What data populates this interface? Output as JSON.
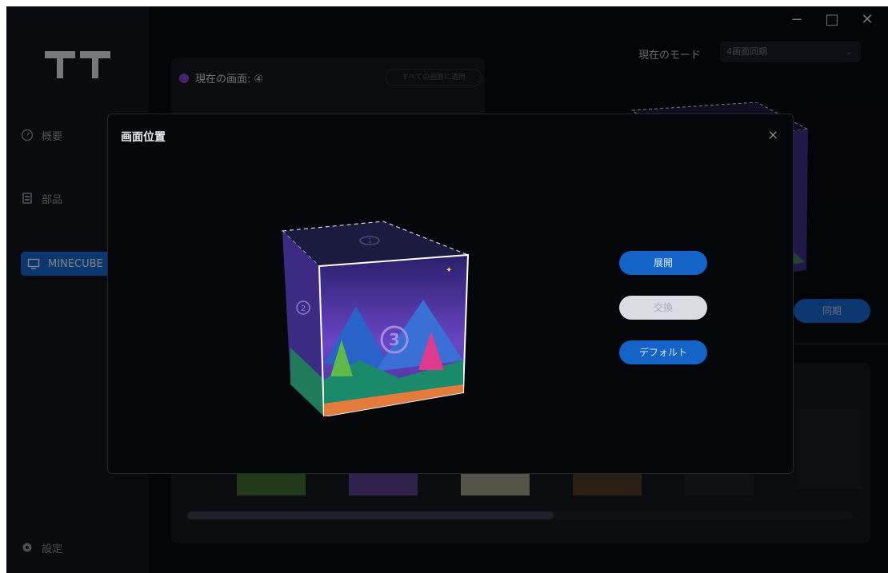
{
  "window": {
    "minimize_icon": "−",
    "maximize_icon": "□",
    "close_icon": "✕"
  },
  "sidebar": {
    "items": [
      {
        "label": "概要",
        "icon": "dashboard-icon"
      },
      {
        "label": "部品",
        "icon": "parts-icon"
      },
      {
        "label": "MINECUBE",
        "icon": "monitor-icon",
        "active": true
      }
    ],
    "settings_label": "設定"
  },
  "header": {
    "mode_label": "現在のモード",
    "mode_value": "4画面同期"
  },
  "screen_panel": {
    "title": "現在の画面: ④",
    "apply_all_label": "すべての画面に適用"
  },
  "sync_label": "同期",
  "scroll": {
    "position": 0.55
  },
  "modal": {
    "title": "画面位置",
    "close": "×",
    "buttons": {
      "expand": "展開",
      "swap": "交換",
      "default": "デフォルト"
    },
    "cube_face_number": "3",
    "cube_top_number": "1",
    "cube_side_number": "2"
  },
  "colors": {
    "accent": "#1463c9",
    "purple_dot": "#7b3fc9"
  }
}
